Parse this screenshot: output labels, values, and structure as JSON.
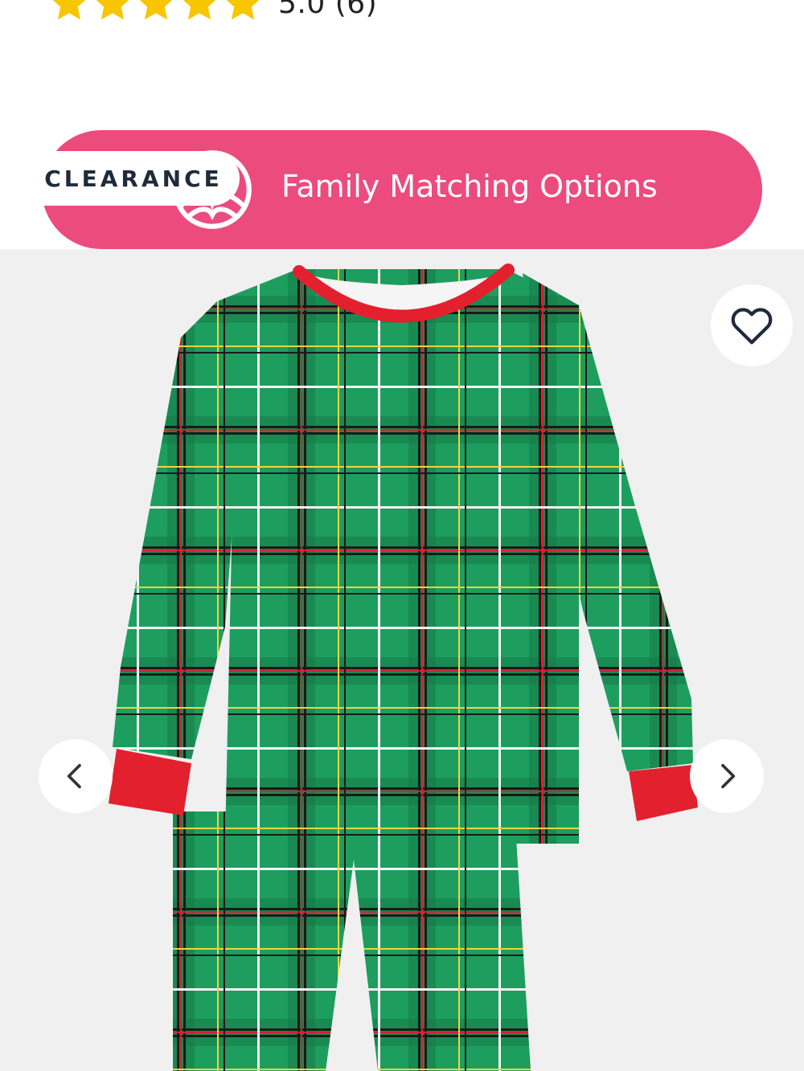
{
  "rating": {
    "value_text": "5.0 (6)",
    "stars": 5,
    "star_color": "#f7c600"
  },
  "banner": {
    "label": "Family Matching Options",
    "color": "#ec4b7e",
    "icon": "family-matching-icon"
  },
  "badge": {
    "label": "CLEARANCE"
  },
  "gallery": {
    "favorite_icon": "heart-icon",
    "prev_icon": "chevron-left-icon",
    "next_icon": "chevron-right-icon",
    "product_colors": {
      "plaid_base": "#1d9e5e",
      "cuffs": "#e3202e"
    }
  }
}
